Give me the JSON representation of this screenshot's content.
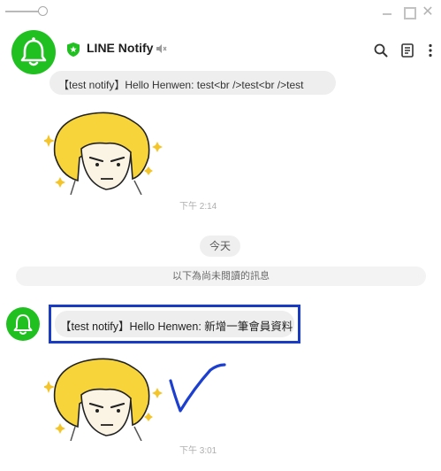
{
  "header": {
    "title": "LINE Notify"
  },
  "chat": {
    "previous_message": "【test notify】Hello Henwen: test<br />test<br />test",
    "time_1": "下午 2:14",
    "date_divider": "今天",
    "unread_divider": "以下為尚未閱讀的訊息",
    "new_message": "【test notify】Hello Henwen: 新增一筆會員資料",
    "time_2": "下午 3:01"
  },
  "colors": {
    "brand_green": "#1fc01f",
    "highlight_border": "#1a3cc2",
    "annotation_blue": "#1c3fd0"
  },
  "icons": {
    "verified": "shield-check-icon",
    "mute": "speaker-muted-icon",
    "search": "search-icon",
    "notes": "notes-icon",
    "more": "more-vertical-icon"
  }
}
